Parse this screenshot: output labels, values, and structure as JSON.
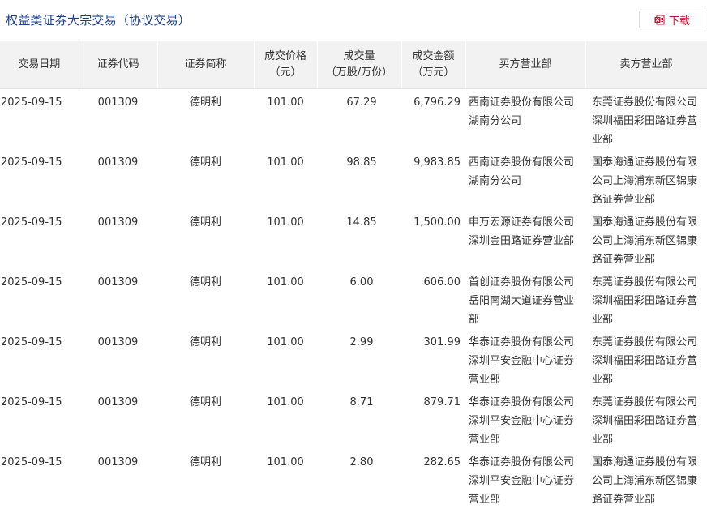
{
  "page": {
    "title": "权益类证券大宗交易（协议交易）",
    "download_label": "下载",
    "accent_color": "#c8102e",
    "title_color": "#1a3f8f"
  },
  "table": {
    "headers": [
      [
        "交易日期"
      ],
      [
        "证券代码"
      ],
      [
        "证券简称"
      ],
      [
        "成交价格",
        "（元）"
      ],
      [
        "成交量",
        "（万股/万份）"
      ],
      [
        "成交金额",
        "（万元）"
      ],
      [
        "买方营业部"
      ],
      [
        "卖方营业部"
      ]
    ],
    "rows": [
      {
        "date": "2025-09-15",
        "code": "001309",
        "name": "德明利",
        "price": "101.00",
        "volume": "67.29",
        "amount": "6,796.29",
        "buyer": "西南证券股份有限公司湖南分公司",
        "seller": "东莞证券股份有限公司深圳福田彩田路证券营业部"
      },
      {
        "date": "2025-09-15",
        "code": "001309",
        "name": "德明利",
        "price": "101.00",
        "volume": "98.85",
        "amount": "9,983.85",
        "buyer": "西南证券股份有限公司湖南分公司",
        "seller": "国泰海通证券股份有限公司上海浦东新区锦康路证券营业部"
      },
      {
        "date": "2025-09-15",
        "code": "001309",
        "name": "德明利",
        "price": "101.00",
        "volume": "14.85",
        "amount": "1,500.00",
        "buyer": "申万宏源证券有限公司深圳金田路证券营业部",
        "seller": "国泰海通证券股份有限公司上海浦东新区锦康路证券营业部"
      },
      {
        "date": "2025-09-15",
        "code": "001309",
        "name": "德明利",
        "price": "101.00",
        "volume": "6.00",
        "amount": "606.00",
        "buyer": "首创证券股份有限公司岳阳南湖大道证券营业部",
        "seller": "东莞证券股份有限公司深圳福田彩田路证券营业部"
      },
      {
        "date": "2025-09-15",
        "code": "001309",
        "name": "德明利",
        "price": "101.00",
        "volume": "2.99",
        "amount": "301.99",
        "buyer": "华泰证券股份有限公司深圳平安金融中心证券营业部",
        "seller": "东莞证券股份有限公司深圳福田彩田路证券营业部"
      },
      {
        "date": "2025-09-15",
        "code": "001309",
        "name": "德明利",
        "price": "101.00",
        "volume": "8.71",
        "amount": "879.71",
        "buyer": "华泰证券股份有限公司深圳平安金融中心证券营业部",
        "seller": "东莞证券股份有限公司深圳福田彩田路证券营业部"
      },
      {
        "date": "2025-09-15",
        "code": "001309",
        "name": "德明利",
        "price": "101.00",
        "volume": "2.80",
        "amount": "282.65",
        "buyer": "华泰证券股份有限公司深圳平安金融中心证券营业部",
        "seller": "国泰海通证券股份有限公司上海浦东新区锦康路证券营业部"
      }
    ]
  }
}
